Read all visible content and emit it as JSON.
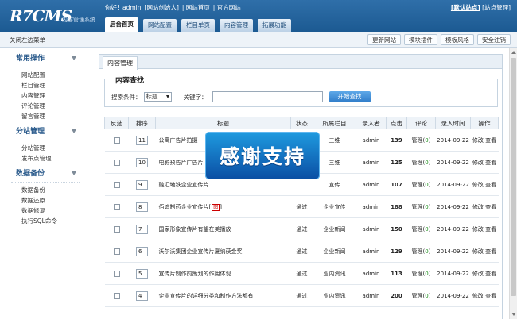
{
  "header": {
    "logo": "R7CMS",
    "logo_subtitle": "内容管理系统",
    "welcome": {
      "greeting": "你好!",
      "user": "admin",
      "role": "[网站创始人]",
      "link_home": "网站首页",
      "link_official": "官方网站"
    },
    "top_right": {
      "default_site": "[默认站点]",
      "site_manage": "[站点管理]"
    },
    "nav_tabs": [
      {
        "label": "后台首页",
        "active": true
      },
      {
        "label": "网站配置",
        "active": false
      },
      {
        "label": "栏目单页",
        "active": false
      },
      {
        "label": "内容管理",
        "active": false
      },
      {
        "label": "拓展功能",
        "active": false
      }
    ]
  },
  "subbar": {
    "hide_menu": "关闭左边菜单",
    "buttons": [
      "更新网站",
      "模块插件",
      "模板风格",
      "安全注销"
    ]
  },
  "sidebar": {
    "sections": [
      {
        "title": "常用操作",
        "items": [
          "网站配置",
          "栏目管理",
          "内容管理",
          "评论管理",
          "留言管理"
        ]
      },
      {
        "title": "分站管理",
        "items": [
          "分站管理",
          "发布点管理"
        ]
      },
      {
        "title": "数据备份",
        "items": [
          "数据备份",
          "数据还原",
          "数据修复",
          "执行SQL命令"
        ]
      }
    ]
  },
  "main": {
    "tab": "内容管理",
    "search": {
      "legend": "内容查找",
      "condition_label": "搜索条件：",
      "condition_value": "标题",
      "keyword_label": "关键字：",
      "keyword_value": "",
      "button": "开始查找"
    },
    "table": {
      "headers": [
        "反选",
        "排序",
        "标题",
        "状态",
        "所属栏目",
        "录入者",
        "点击",
        "评论",
        "录入时间",
        "操作"
      ],
      "rows": [
        {
          "order": "11",
          "title": "公寓广告片拍摄",
          "status": "",
          "category": "三维",
          "author": "admin",
          "hits": "139",
          "comment": "管理",
          "comment_count": "0",
          "date": "2014-09-22",
          "ops1": "修改",
          "ops2": "查看",
          "has_image": false
        },
        {
          "order": "10",
          "title": "电影预告片广告片",
          "status": "",
          "category": "三维",
          "author": "admin",
          "hits": "125",
          "comment": "管理",
          "comment_count": "0",
          "date": "2014-09-22",
          "ops1": "修改",
          "ops2": "查看",
          "has_image": false
        },
        {
          "order": "9",
          "title": "融汇地铁企业宣传片",
          "status": "",
          "category": "宣传",
          "author": "admin",
          "hits": "107",
          "comment": "管理",
          "comment_count": "0",
          "date": "2014-09-22",
          "ops1": "修改",
          "ops2": "查看",
          "has_image": false
        },
        {
          "order": "8",
          "title": "佰谊制药企业宣传片",
          "status": "通过",
          "category": "企业宣传",
          "author": "admin",
          "hits": "188",
          "comment": "管理",
          "comment_count": "0",
          "date": "2014-09-22",
          "ops1": "修改",
          "ops2": "查看",
          "has_image": true,
          "image_badge": "图"
        },
        {
          "order": "7",
          "title": "国家形象宣传片有望在美播放",
          "status": "通过",
          "category": "企业新闻",
          "author": "admin",
          "hits": "150",
          "comment": "管理",
          "comment_count": "0",
          "date": "2014-09-22",
          "ops1": "修改",
          "ops2": "查看",
          "has_image": false
        },
        {
          "order": "6",
          "title": "沃尔沃集团企业宣传片夏纳获金奖",
          "status": "通过",
          "category": "企业新闻",
          "author": "admin",
          "hits": "129",
          "comment": "管理",
          "comment_count": "0",
          "date": "2014-09-22",
          "ops1": "修改",
          "ops2": "查看",
          "has_image": false
        },
        {
          "order": "5",
          "title": "宣传片制作前策划的作用体现",
          "status": "通过",
          "category": "业内资讯",
          "author": "admin",
          "hits": "113",
          "comment": "管理",
          "comment_count": "0",
          "date": "2014-09-22",
          "ops1": "修改",
          "ops2": "查看",
          "has_image": false
        },
        {
          "order": "4",
          "title": "企业宣传片的详细分类和制作方法都有",
          "status": "通过",
          "category": "业内资讯",
          "author": "admin",
          "hits": "200",
          "comment": "管理",
          "comment_count": "0",
          "date": "2014-09-22",
          "ops1": "修改",
          "ops2": "查看",
          "has_image": false
        }
      ]
    }
  },
  "overlay": {
    "text": "感谢支持"
  }
}
